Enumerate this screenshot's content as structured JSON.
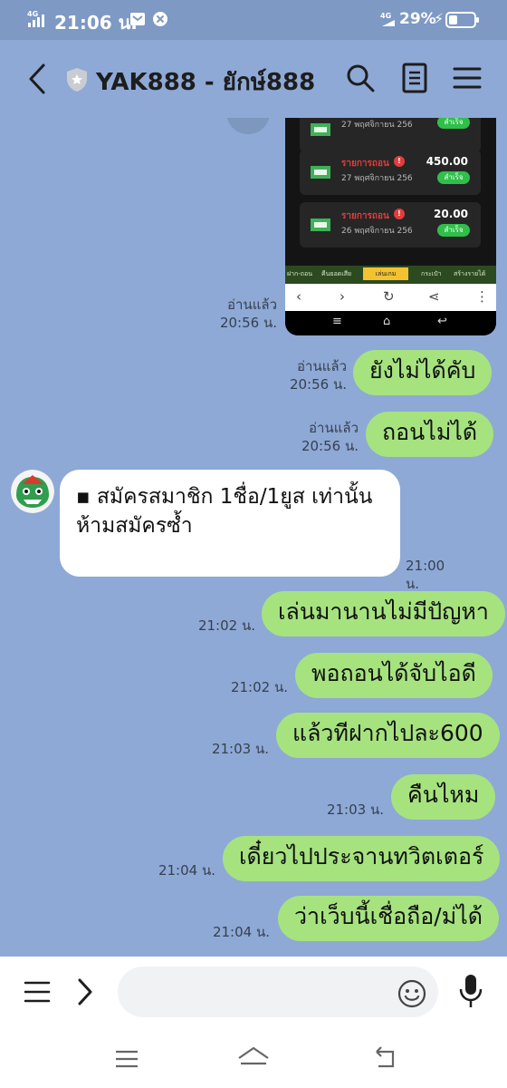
{
  "status_bar": {
    "network": "4G",
    "time": "21:06 น.",
    "battery": "29%"
  },
  "header": {
    "title": "YAK888 - ยักษ์888",
    "icons": [
      "back-arrow-icon",
      "shield-icon",
      "search-icon",
      "notes-icon",
      "menu-icon"
    ]
  },
  "messages": {
    "image_msg": {
      "read": "อ่านแล้ว",
      "time": "20:56 น.",
      "thumbnail": {
        "cards": [
          {
            "label": "",
            "date": "27 พฤศจิกายน 256",
            "amount": "",
            "status": "สำเร็จ"
          },
          {
            "label": "รายการถอน",
            "date": "27 พฤศจิกายน 256",
            "amount": "450.00",
            "status": "สำเร็จ"
          },
          {
            "label": "รายการถอน",
            "date": "26 พฤศจิกายน 256",
            "amount": "20.00",
            "status": "สำเร็จ"
          }
        ],
        "nav": [
          "ฝาก-ถอน",
          "คืนยอดเสีย",
          "เล่นเกม",
          "กระเป๋า",
          "สร้างรายได้"
        ]
      }
    },
    "m1": {
      "text": "ยังไม่ได้คับ",
      "read": "อ่านแล้ว",
      "time": "20:56 น."
    },
    "m2": {
      "text": "ถอนไม่ได้",
      "read": "อ่านแล้ว",
      "time": "20:56 น."
    },
    "incoming": {
      "text": "▪ สมัครสมาชิก 1ชื่อ/1ยูส เท่านั้น ห้ามสมัครซ้ำ",
      "time": "21:00 น."
    },
    "m3": {
      "text": "เล่นมานานไม่มีปัญหา",
      "time": "21:02 น."
    },
    "m4": {
      "text": "พอถอนได้จับไอดี",
      "time": "21:02 น."
    },
    "m5": {
      "text": "แล้วทีฝากไปละ600",
      "time": "21:03 น."
    },
    "m6": {
      "text": "คืนไหม",
      "time": "21:03 น."
    },
    "m7": {
      "text": "เดี๋ยวไปประจานทวิตเตอร์",
      "time": "21:04 น."
    },
    "m8": {
      "text": "ว่าเว็บนี้เชื่อถือ/ม่ได้",
      "time": "21:04 น."
    }
  },
  "input_bar": {
    "placeholder": "",
    "value": ""
  },
  "colors": {
    "chat_bg": "#8ea9d6",
    "outgoing_bubble": "#a6e37f",
    "incoming_bubble": "#ffffff"
  }
}
